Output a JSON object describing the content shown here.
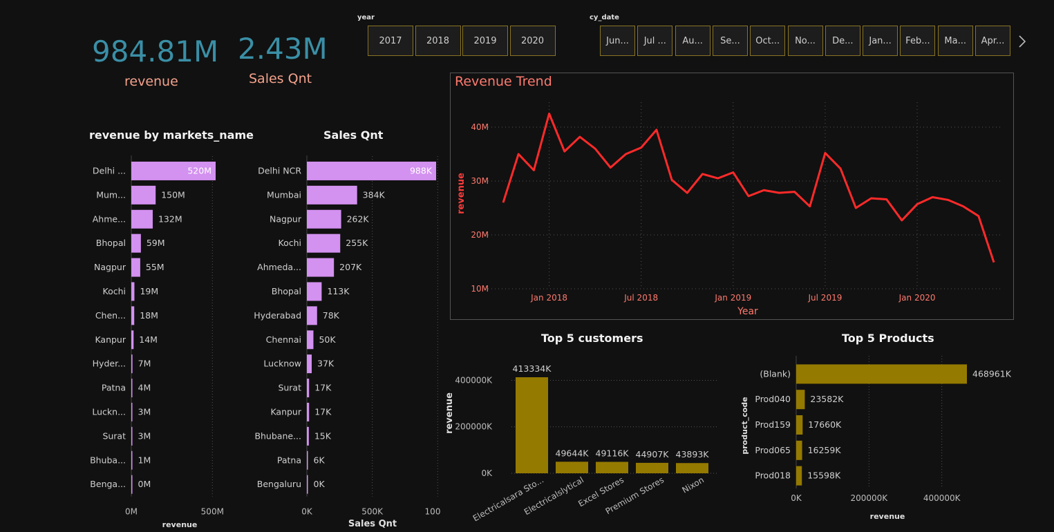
{
  "kpis": {
    "revenue_value": "984.81M",
    "revenue_label": "revenue",
    "qty_value": "2.43M",
    "qty_label": "Sales Qnt"
  },
  "year_slicer": {
    "title": "year",
    "options": [
      "2017",
      "2018",
      "2019",
      "2020"
    ]
  },
  "date_slicer": {
    "title": "cy_date",
    "options": [
      "Jun...",
      "Jul ...",
      "Au...",
      "Se...",
      "Oct...",
      "No...",
      "De...",
      "Jan...",
      "Feb...",
      "Ma...",
      "Apr..."
    ],
    "next_icon": "chevron-right-icon"
  },
  "colors": {
    "market_bar": "#d391f0",
    "trend_line": "#ff2a2a",
    "gold_bar": "#957a00",
    "trend_title": "#ff7a6e"
  },
  "chart_data": [
    {
      "id": "revenue_by_market",
      "type": "bar",
      "orientation": "horizontal",
      "title": "revenue by markets_name",
      "xlabel": "revenue",
      "ylabel": "",
      "categories": [
        "Delhi ...",
        "Mum...",
        "Ahme...",
        "Bhopal",
        "Nagpur",
        "Kochi",
        "Chen...",
        "Kanpur",
        "Hyder...",
        "Patna",
        "Luckn...",
        "Surat",
        "Bhuba...",
        "Benga..."
      ],
      "values": [
        520,
        150,
        132,
        59,
        55,
        19,
        18,
        14,
        7,
        4,
        3,
        3,
        1,
        0
      ],
      "labels": [
        "520M",
        "150M",
        "132M",
        "59M",
        "55M",
        "19M",
        "18M",
        "14M",
        "7M",
        "4M",
        "3M",
        "3M",
        "1M",
        "0M"
      ],
      "xlim": [
        0,
        520
      ],
      "xticks": [
        0,
        500
      ],
      "xtick_labels": [
        "0M",
        "500M"
      ]
    },
    {
      "id": "sales_qty_by_market",
      "type": "bar",
      "orientation": "horizontal",
      "title": "Sales Qnt",
      "xlabel": "Sales Qnt",
      "ylabel": "",
      "categories": [
        "Delhi NCR",
        "Mumbai",
        "Nagpur",
        "Kochi",
        "Ahmeda...",
        "Bhopal",
        "Hyderabad",
        "Chennai",
        "Lucknow",
        "Surat",
        "Kanpur",
        "Bhubane...",
        "Patna",
        "Bengaluru"
      ],
      "values": [
        988,
        384,
        262,
        255,
        207,
        113,
        78,
        50,
        37,
        17,
        17,
        15,
        6,
        0
      ],
      "labels": [
        "988K",
        "384K",
        "262K",
        "255K",
        "207K",
        "113K",
        "78K",
        "50K",
        "37K",
        "17K",
        "17K",
        "15K",
        "6K",
        "0K"
      ],
      "xlim": [
        0,
        988
      ],
      "xticks": [
        0,
        500,
        1000
      ],
      "xtick_labels": [
        "0K",
        "500K",
        "100"
      ]
    },
    {
      "id": "revenue_trend",
      "type": "line",
      "title": "Revenue Trend",
      "xlabel": "Year",
      "ylabel": "revenue",
      "x_start": "2017-10",
      "x_end": "2020-06",
      "values": [
        26,
        35,
        32,
        42.5,
        35.5,
        38.2,
        36,
        32.5,
        35,
        36.2,
        39.5,
        30.2,
        27.8,
        31.3,
        30.5,
        31.6,
        27.2,
        28.3,
        27.8,
        28,
        25.3,
        35.2,
        32.3,
        25,
        26.8,
        26.6,
        22.7,
        25.7,
        27,
        26.5,
        25.3,
        23.5,
        14.9
      ],
      "ylim": [
        10,
        45
      ],
      "yticks": [
        10,
        20,
        30,
        40
      ],
      "ytick_labels": [
        "10M",
        "20M",
        "30M",
        "40M"
      ],
      "xtick_labels": [
        "Jan 2018",
        "Jul 2018",
        "Jan 2019",
        "Jul 2019",
        "Jan 2020"
      ],
      "xtick_index": [
        3,
        9,
        15,
        21,
        27
      ]
    },
    {
      "id": "top_customers",
      "type": "bar",
      "orientation": "vertical",
      "title": "Top 5 customers",
      "xlabel": "",
      "ylabel": "revenue",
      "categories": [
        "Electricalsara Sto...",
        "Electricalslytical",
        "Excel Stores",
        "Premium Stores",
        "Nixon"
      ],
      "values": [
        413334,
        49644,
        49116,
        44907,
        43893
      ],
      "labels": [
        "413334K",
        "49644K",
        "49116K",
        "44907K",
        "43893K"
      ],
      "ylim": [
        0,
        413334
      ],
      "yticks": [
        0,
        200000,
        400000
      ],
      "ytick_labels": [
        "0K",
        "200000K",
        "400000K"
      ]
    },
    {
      "id": "top_products",
      "type": "bar",
      "orientation": "horizontal",
      "title": "Top 5 Products",
      "xlabel": "revenue",
      "ylabel": "product_code",
      "categories": [
        "(Blank)",
        "Prod040",
        "Prod159",
        "Prod065",
        "Prod018"
      ],
      "values": [
        468961,
        23582,
        17660,
        16259,
        15598
      ],
      "labels": [
        "468961K",
        "23582K",
        "17660K",
        "16259K",
        "15598K"
      ],
      "xlim": [
        0,
        468961
      ],
      "xticks": [
        0,
        200000,
        400000
      ],
      "xtick_labels": [
        "0K",
        "200000K",
        "400000K"
      ]
    }
  ]
}
